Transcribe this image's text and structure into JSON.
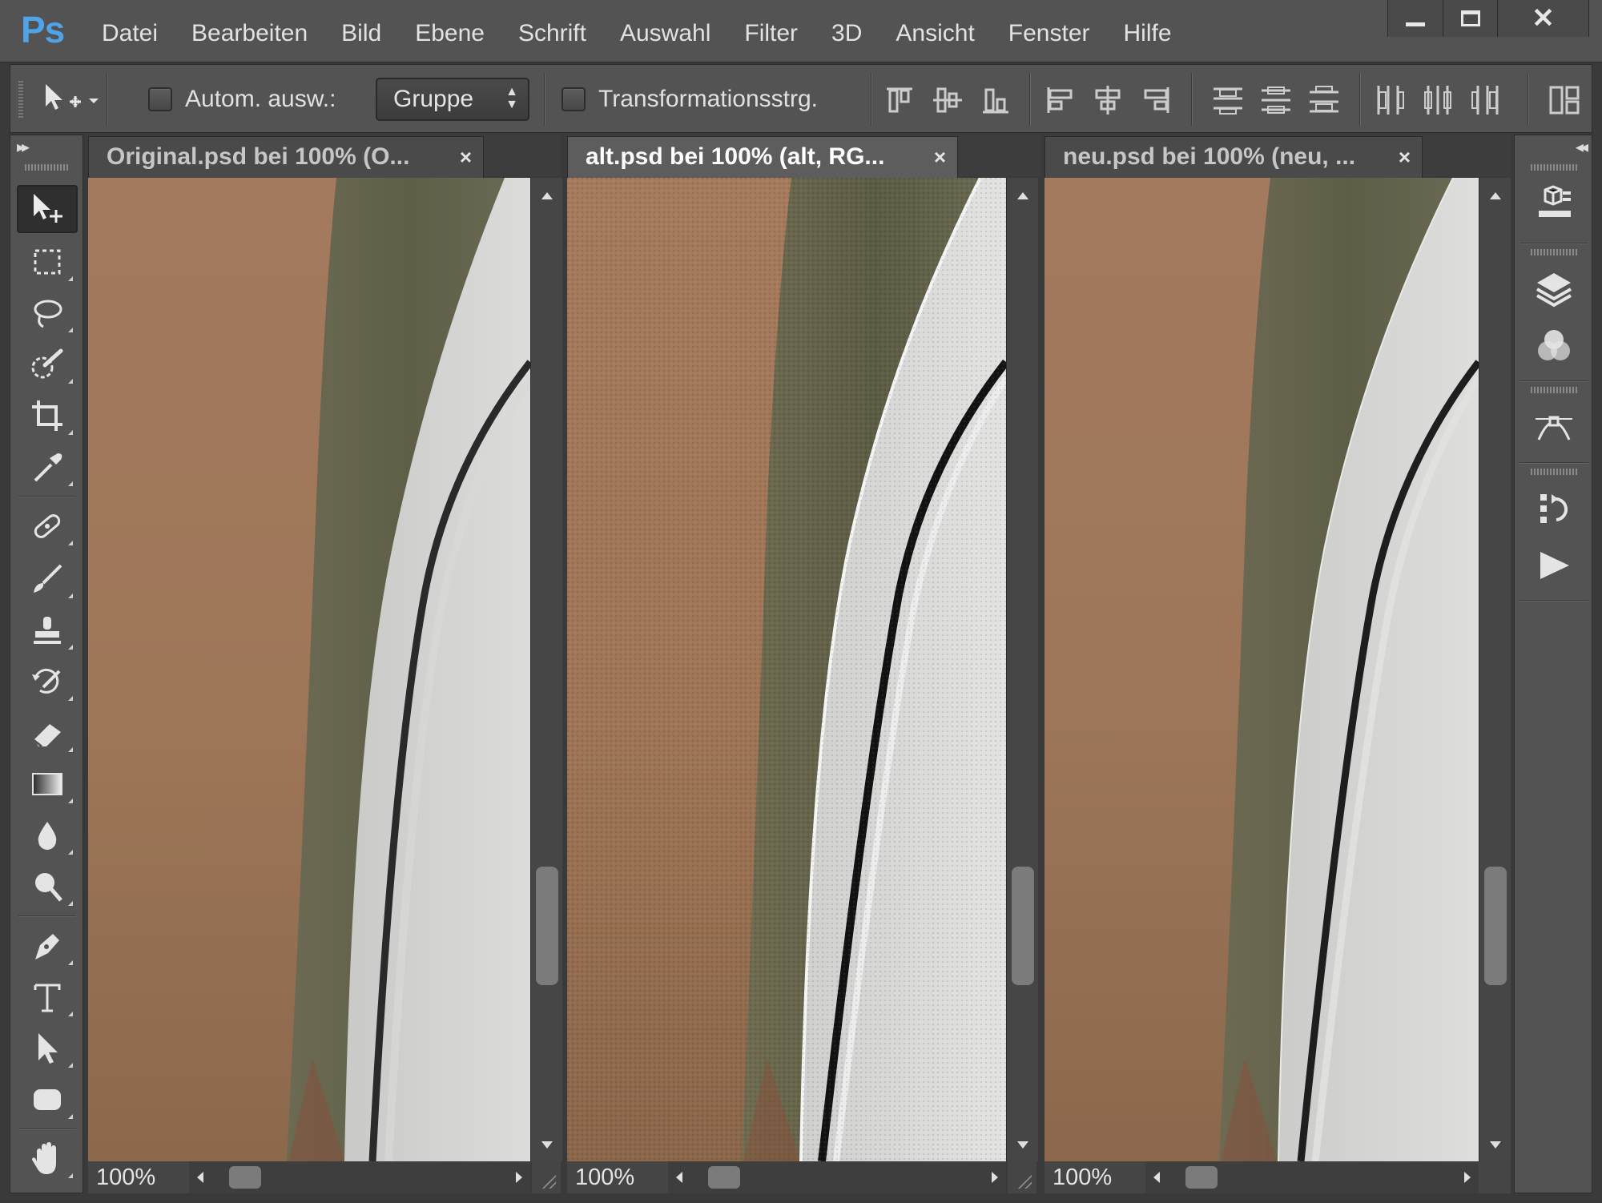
{
  "app": {
    "logo": "Ps"
  },
  "menu": [
    "Datei",
    "Bearbeiten",
    "Bild",
    "Ebene",
    "Schrift",
    "Auswahl",
    "Filter",
    "3D",
    "Ansicht",
    "Fenster",
    "Hilfe"
  ],
  "window_controls": {
    "minimize": "minimize-icon",
    "maximize": "maximize-icon",
    "close": "✕"
  },
  "options": {
    "tool_icon": "move-tool-icon",
    "auto_select_label": "Autom. ausw.:",
    "auto_select_checked": false,
    "group_select_value": "Gruppe",
    "transform_label": "Transformationsstrg.",
    "transform_checked": false,
    "align_icons": [
      "align-top-edges-icon",
      "align-vertical-centers-icon",
      "align-bottom-edges-icon",
      "align-left-edges-icon",
      "align-horizontal-centers-icon",
      "align-right-edges-icon"
    ],
    "distribute_icons": [
      "distribute-top-icon",
      "distribute-vertical-centers-icon",
      "distribute-bottom-icon",
      "distribute-left-icon",
      "distribute-horizontal-centers-icon",
      "distribute-right-icon"
    ],
    "auto_align_icon": "auto-align-layers-icon"
  },
  "tools": [
    "move-tool",
    "rectangular-marquee-tool",
    "lasso-tool",
    "quick-selection-tool",
    "crop-tool",
    "eyedropper-tool",
    "spot-healing-brush-tool",
    "brush-tool",
    "clone-stamp-tool",
    "history-brush-tool",
    "eraser-tool",
    "gradient-tool",
    "blur-tool",
    "dodge-tool",
    "pen-tool",
    "type-tool",
    "path-selection-tool",
    "rectangle-tool",
    "hand-tool"
  ],
  "documents": [
    {
      "tab": "Original.psd bei 100% (O...",
      "close": "×",
      "zoom": "100%",
      "active": false,
      "variant": "original"
    },
    {
      "tab": "alt.psd bei 100% (alt, RG...",
      "close": "×",
      "zoom": "100%",
      "active": true,
      "variant": "alt"
    },
    {
      "tab": "neu.psd bei 100% (neu, ...",
      "close": "×",
      "zoom": "100%",
      "active": false,
      "variant": "neu"
    }
  ],
  "right_panel": [
    "3d-panel-icon",
    "layers-panel-icon",
    "channels-panel-icon",
    "paths-panel-icon",
    "history-panel-icon",
    "actions-panel-icon"
  ],
  "colors": {
    "panel": "#535353",
    "dark": "#3a3a3a",
    "ps_blue": "#4fa3e8",
    "brown_bg": "#a2775c",
    "green_strip": "#6a684f",
    "white_disc": "#d6d6d4"
  }
}
